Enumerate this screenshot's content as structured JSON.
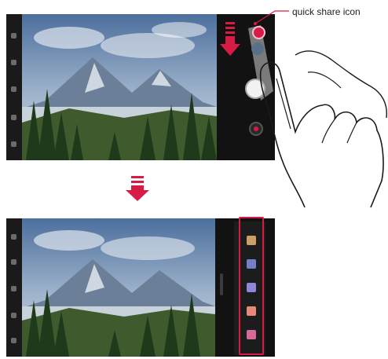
{
  "callout": {
    "label": "quick share icon"
  },
  "icons": {
    "swipe_arrow": "arrow-down-icon",
    "step_arrow": "arrow-down-icon",
    "hand": "hand-gesture-icon",
    "quick_share": "quick-share-icon",
    "shutter": "shutter-icon",
    "video": "video-record-icon"
  },
  "colors": {
    "accent": "#d81b45",
    "highlight_box": "#d81b45",
    "share_targets": [
      "#c9a06a",
      "#6f7fc9",
      "#8f86d8",
      "#e58a7a",
      "#d46a9a",
      "#a8a8ff"
    ]
  }
}
